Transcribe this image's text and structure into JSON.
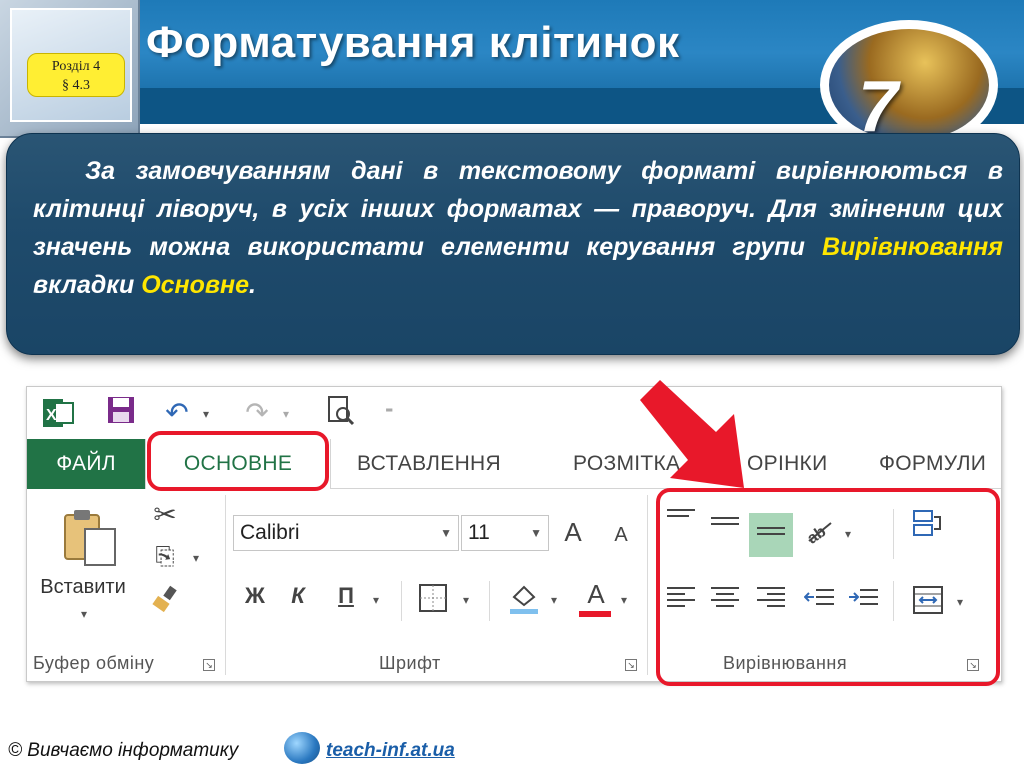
{
  "header": {
    "title": "Форматування клітинок",
    "section_line1": "Розділ 4",
    "section_line2": "§ 4.3",
    "book_number": "7"
  },
  "callout": {
    "text_before": "За замовчуванням дані в текстовому форматі вирівнюються в клітинці ліворуч, в усіх інших форматах — праворуч. Для зміненим цих значень можна використати елементи керування групи ",
    "group_name": "Вирівнювання",
    "text_middle": " вкладки ",
    "tab_name": "Основне",
    "text_end": "."
  },
  "ribbon": {
    "tabs": {
      "file": "ФАЙЛ",
      "home": "ОСНОВНЕ",
      "insert": "ВСТАВЛЕННЯ",
      "layout": "РОЗМІТКА",
      "layout_tail": "ОРІНКИ",
      "formulas": "ФОРМУЛИ"
    },
    "clipboard": {
      "paste_label": "Вставити",
      "group_label": "Буфер обміну"
    },
    "font": {
      "font_name": "Calibri",
      "font_size": "11",
      "bold": "Ж",
      "italic": "К",
      "underline": "П",
      "grow": "A",
      "shrink": "A",
      "font_color": "A",
      "group_label": "Шрифт"
    },
    "alignment": {
      "group_label": "Вирівнювання"
    }
  },
  "footer": {
    "text": "© Вивчаємо інформатику",
    "link": "teach-inf.at.ua"
  },
  "colors": {
    "header_blue": "#2b86c4",
    "callout_bg": "#1f4b6c",
    "highlight_yellow": "#ffe600",
    "excel_green": "#217346",
    "red_marker": "#e8182a"
  }
}
